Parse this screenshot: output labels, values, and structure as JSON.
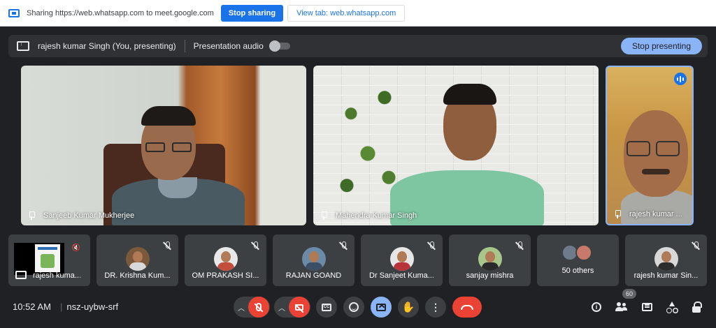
{
  "share_bar": {
    "text": "Sharing https://web.whatsapp.com to meet.google.com",
    "stop_sharing_label": "Stop sharing",
    "view_tab_label": "View tab: web.whatsapp.com"
  },
  "present_bar": {
    "presenter_label": "rajesh kumar Singh (You, presenting)",
    "audio_label": "Presentation audio",
    "audio_enabled": false,
    "stop_presenting_label": "Stop presenting"
  },
  "main_tiles": [
    {
      "name": "Sanjeeb Kumar Mukherjee"
    },
    {
      "name": "Mahendra Kumar Singh"
    },
    {
      "name": "rajesh kumar ...",
      "speaking": true
    }
  ],
  "participants": [
    {
      "name": "rajesh kuma...",
      "muted": true
    },
    {
      "name": "DR. Krishna Kum...",
      "muted": true
    },
    {
      "name": "OM PRAKASH SI...",
      "muted": true
    },
    {
      "name": "RAJAN GOAND",
      "muted": true
    },
    {
      "name": "Dr Sanjeet Kuma...",
      "muted": true
    },
    {
      "name": "sanjay mishra",
      "muted": true
    },
    {
      "name": "50 others"
    },
    {
      "name": "rajesh kumar Sin...",
      "muted": true
    }
  ],
  "toolbar": {
    "time": "10:52 AM",
    "meeting_code": "nsz-uybw-srf",
    "mic_on": false,
    "camera_on": false,
    "presenting": true
  },
  "people_count": "60",
  "colors": {
    "accent_blue": "#1a73e8",
    "light_blue": "#8ab4f8",
    "danger_red": "#ea4335",
    "background": "#202124",
    "surface": "#3c4043"
  }
}
